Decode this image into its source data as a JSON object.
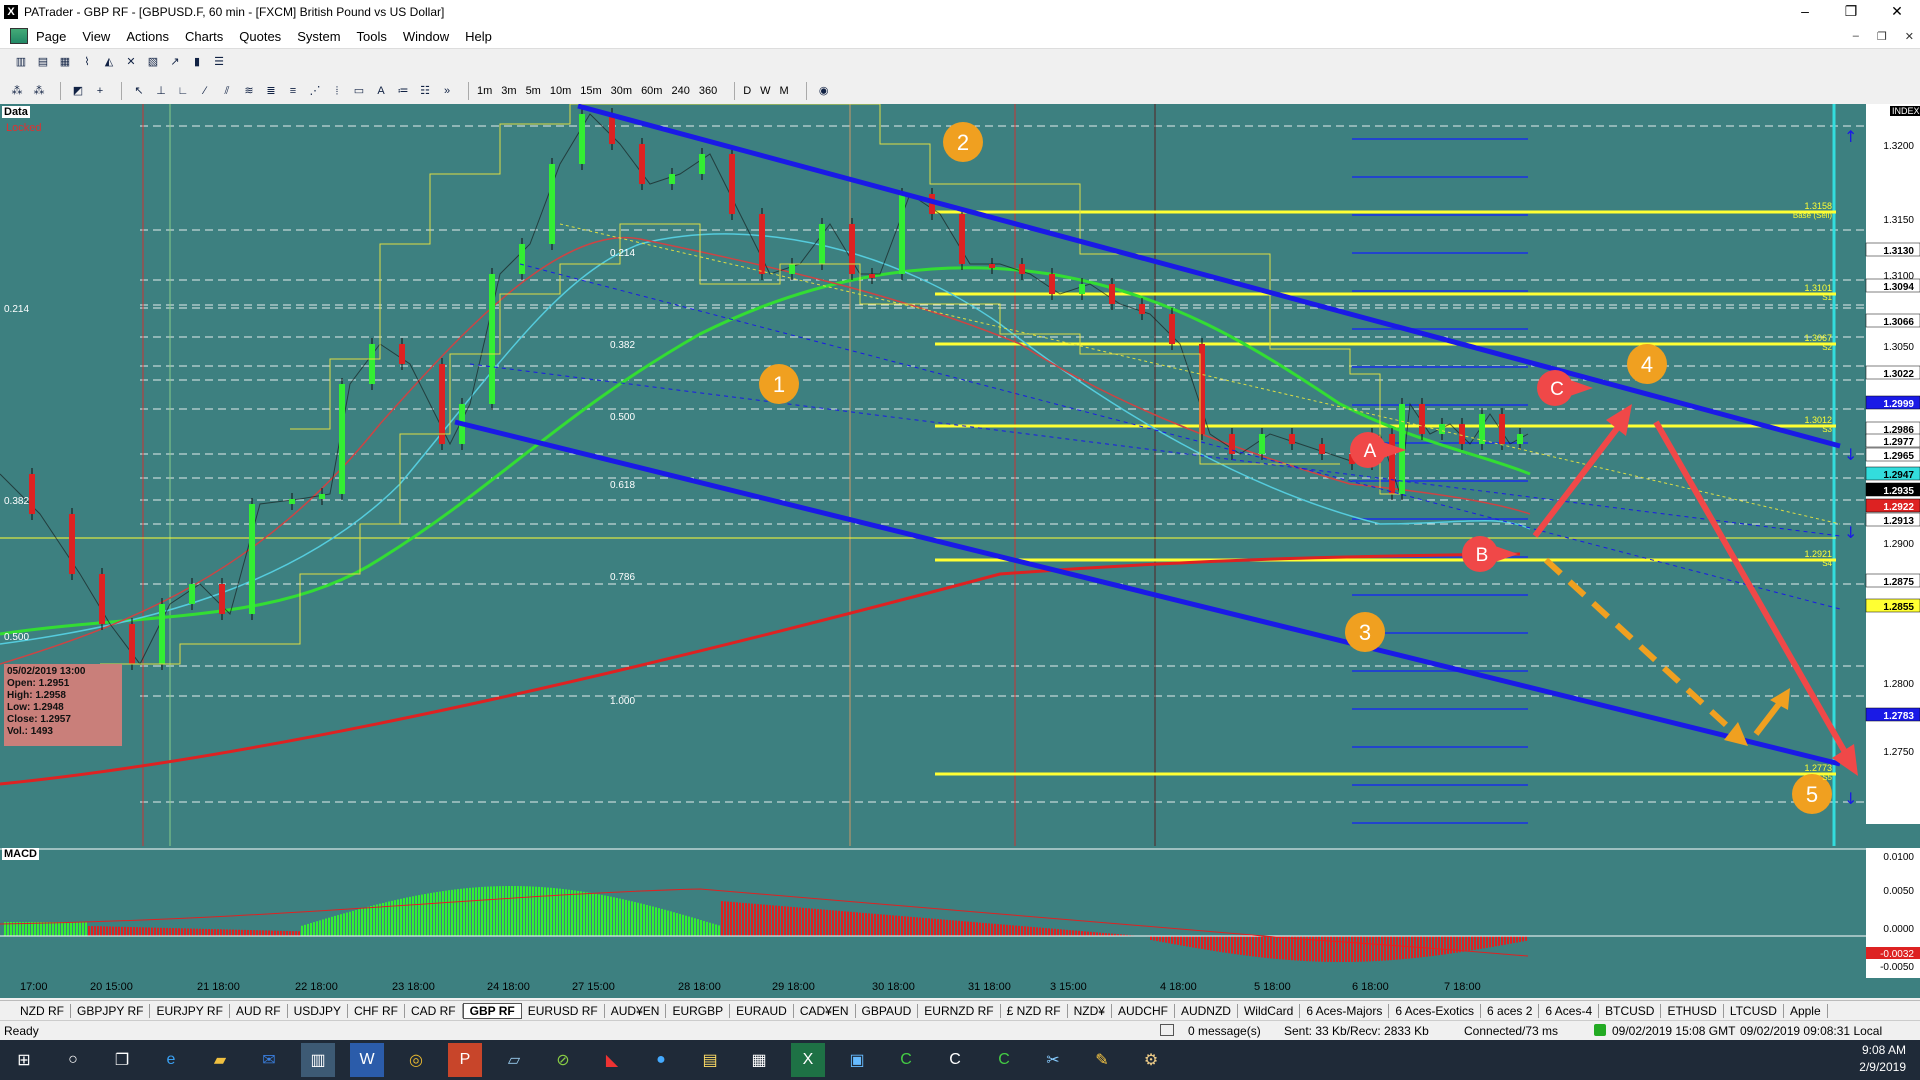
{
  "window": {
    "title": "PATrader - GBP RF - [GBPUSD.F, 60 min - [FXCM] British Pound vs US Dollar]",
    "buttons": [
      "–",
      "❐",
      "✕"
    ]
  },
  "menu": {
    "items": [
      "Page",
      "View",
      "Actions",
      "Charts",
      "Quotes",
      "System",
      "Tools",
      "Window",
      "Help"
    ],
    "mdi_buttons": [
      "–",
      "❐",
      "✕"
    ]
  },
  "toolbar2": {
    "timeframes": [
      "1m",
      "3m",
      "5m",
      "10m",
      "15m",
      "30m",
      "60m",
      "240",
      "360"
    ],
    "periods": [
      "D",
      "W",
      "M"
    ]
  },
  "chart": {
    "data_label": "Data",
    "locked_label": "Locked",
    "macd_label": "MACD",
    "index_label": "INDEX",
    "left_fib_labels": [
      {
        "text": "0.214"
      },
      {
        "text": "0.382"
      },
      {
        "text": "0.500"
      }
    ],
    "fib_labels": [
      {
        "text": "0.214"
      },
      {
        "text": "0.382"
      },
      {
        "text": "0.500"
      },
      {
        "text": "0.618"
      },
      {
        "text": "0.786"
      },
      {
        "text": "1.000"
      }
    ],
    "pivot_labels": [
      {
        "text": "1.3158",
        "sub": "Base (Sell)"
      },
      {
        "text": "1.3101",
        "sub": "S1"
      },
      {
        "text": "1.3067",
        "sub": "S2"
      },
      {
        "text": "1.3012",
        "sub": "S3"
      },
      {
        "text": "1.2921",
        "sub": "S4"
      },
      {
        "text": "1.2773",
        "sub": "S5"
      }
    ],
    "price_axis": [
      {
        "text": "1.3200",
        "hl": ""
      },
      {
        "text": "1.3150",
        "hl": ""
      },
      {
        "text": "1.3130",
        "hl": "white"
      },
      {
        "text": "1.3100",
        "hl": ""
      },
      {
        "text": "1.3094",
        "hl": "white"
      },
      {
        "text": "1.3066",
        "hl": "white"
      },
      {
        "text": "1.3050",
        "hl": ""
      },
      {
        "text": "1.3022",
        "hl": "white"
      },
      {
        "text": "1.2999",
        "hl": "blue"
      },
      {
        "text": "1.2986",
        "hl": "white"
      },
      {
        "text": "1.2977",
        "hl": "white"
      },
      {
        "text": "1.2965",
        "hl": "white"
      },
      {
        "text": "1.2947",
        "hl": "cyan"
      },
      {
        "text": "1.2935",
        "hl": "black"
      },
      {
        "text": "1.2922",
        "hl": "red"
      },
      {
        "text": "1.2913",
        "hl": "white"
      },
      {
        "text": "1.2900",
        "hl": ""
      },
      {
        "text": "1.2875",
        "hl": "white"
      },
      {
        "text": "1.2855",
        "hl": "yellow"
      },
      {
        "text": "1.2800",
        "hl": ""
      },
      {
        "text": "1.2783",
        "hl": "blue"
      },
      {
        "text": "1.2750",
        "hl": ""
      }
    ],
    "macd_axis": [
      {
        "text": "0.0100",
        "hl": ""
      },
      {
        "text": "0.0050",
        "hl": ""
      },
      {
        "text": "0.0000",
        "hl": ""
      },
      {
        "text": "-0.0032",
        "hl": "red"
      },
      {
        "text": "-0.0050",
        "hl": ""
      }
    ],
    "time_axis": [
      "17:00",
      "20 15:00",
      "21 18:00",
      "22 18:00",
      "23 18:00",
      "24 18:00",
      "27 15:00",
      "28 18:00",
      "29 18:00",
      "30 18:00",
      "31 18:00",
      "3 15:00",
      "4 18:00",
      "5 18:00",
      "6 18:00",
      "7 18:00"
    ],
    "info": {
      "date": "05/02/2019 13:00",
      "open": "Open: 1.2951",
      "high": "High: 1.2958",
      "low": "Low: 1.2948",
      "close": "Close: 1.2957",
      "vol": "Vol.: 1493"
    },
    "wave_markers": [
      "1",
      "2",
      "3",
      "4",
      "5"
    ],
    "abc_markers": [
      "A",
      "B",
      "C"
    ],
    "colors": {
      "background": "#3d8080",
      "channel": "#1a1ae6",
      "ma_long": "#dd2222",
      "ma_green": "#33dd33",
      "pivot": "#ffff33",
      "marker": "#f0a020",
      "arrow": "#f04848",
      "projection": "#f0a020"
    }
  },
  "symbol_tabs": [
    "NZD RF",
    "GBPJPY RF",
    "EURJPY RF",
    "AUD RF",
    "USDJPY",
    "CHF RF",
    "CAD RF",
    "GBP RF",
    "EURUSD RF",
    "AUD¥EN",
    "EURGBP",
    "EURAUD",
    "CAD¥EN",
    "GBPAUD",
    "EURNZD RF",
    "£ NZD RF",
    "NZD¥",
    "AUDCHF",
    "AUDNZD",
    "WildCard",
    "6 Aces-Majors",
    "6 Aces-Exotics",
    "6 aces 2",
    "6 Aces-4",
    "BTCUSD",
    "ETHUSD",
    "LTCUSD",
    "Apple"
  ],
  "active_tab": "GBP RF",
  "status": {
    "ready": "Ready",
    "messages": "0 message(s)",
    "traffic": "Sent: 33 Kb/Recv: 2833 Kb",
    "connection": "Connected/73 ms",
    "gmt": "09/02/2019 15:08 GMT",
    "local": "09/02/2019 09:08:31 Local"
  },
  "taskbar": {
    "time": "9:08 AM",
    "date": "2/9/2019",
    "apps": [
      "start-icon",
      "search-icon",
      "task-view-icon",
      "edge-icon",
      "explorer-icon",
      "outlook-icon",
      "patrader-icon",
      "word-icon",
      "chrome-icon",
      "powerpoint-icon",
      "notes-icon",
      "ninja-icon",
      "red-app-icon",
      "zoom-icon",
      "sticky-notes-icon",
      "calculator-icon",
      "excel-icon",
      "photos-icon",
      "camtasia-icon",
      "camtasia-recorder-icon",
      "camtasia-editor-icon",
      "snip-icon",
      "paint-icon",
      "tools-icon"
    ]
  }
}
